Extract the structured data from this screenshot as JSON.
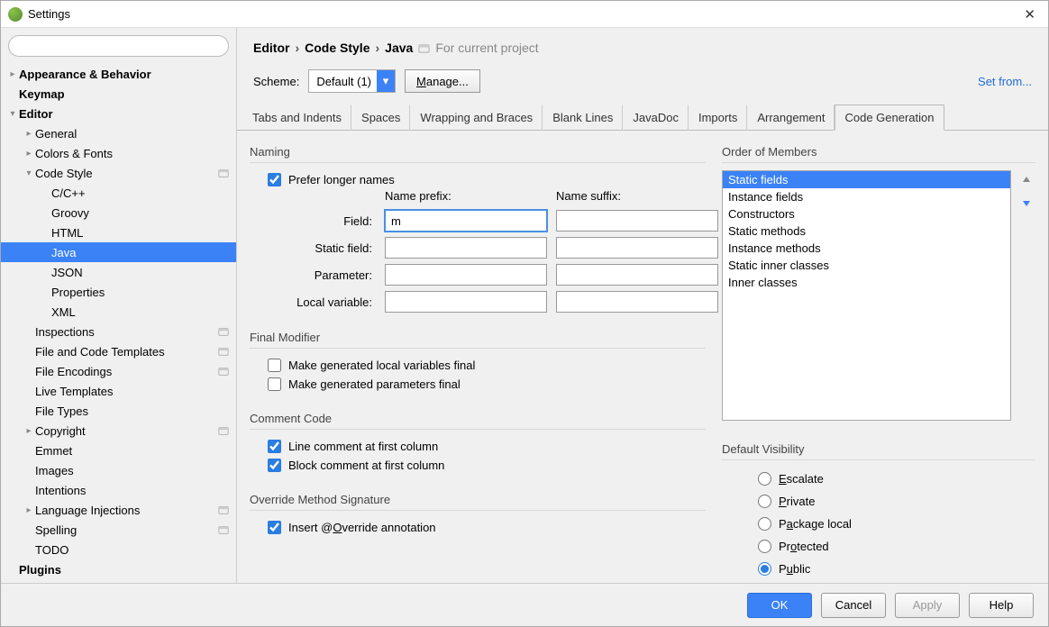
{
  "window": {
    "title": "Settings"
  },
  "sidebar": {
    "search_placeholder": "",
    "items": [
      {
        "label": "Appearance & Behavior",
        "depth": 0,
        "arrow": "right",
        "bold": true
      },
      {
        "label": "Keymap",
        "depth": 0,
        "arrow": "none",
        "bold": true
      },
      {
        "label": "Editor",
        "depth": 0,
        "arrow": "down",
        "bold": true
      },
      {
        "label": "General",
        "depth": 1,
        "arrow": "right"
      },
      {
        "label": "Colors & Fonts",
        "depth": 1,
        "arrow": "right"
      },
      {
        "label": "Code Style",
        "depth": 1,
        "arrow": "down",
        "project": true
      },
      {
        "label": "C/C++",
        "depth": 2,
        "arrow": "none"
      },
      {
        "label": "Groovy",
        "depth": 2,
        "arrow": "none"
      },
      {
        "label": "HTML",
        "depth": 2,
        "arrow": "none"
      },
      {
        "label": "Java",
        "depth": 2,
        "arrow": "none",
        "selected": true
      },
      {
        "label": "JSON",
        "depth": 2,
        "arrow": "none"
      },
      {
        "label": "Properties",
        "depth": 2,
        "arrow": "none"
      },
      {
        "label": "XML",
        "depth": 2,
        "arrow": "none"
      },
      {
        "label": "Inspections",
        "depth": 1,
        "arrow": "none",
        "project": true
      },
      {
        "label": "File and Code Templates",
        "depth": 1,
        "arrow": "none",
        "project": true
      },
      {
        "label": "File Encodings",
        "depth": 1,
        "arrow": "none",
        "project": true
      },
      {
        "label": "Live Templates",
        "depth": 1,
        "arrow": "none"
      },
      {
        "label": "File Types",
        "depth": 1,
        "arrow": "none"
      },
      {
        "label": "Copyright",
        "depth": 1,
        "arrow": "right",
        "project": true
      },
      {
        "label": "Emmet",
        "depth": 1,
        "arrow": "none"
      },
      {
        "label": "Images",
        "depth": 1,
        "arrow": "none"
      },
      {
        "label": "Intentions",
        "depth": 1,
        "arrow": "none"
      },
      {
        "label": "Language Injections",
        "depth": 1,
        "arrow": "right",
        "project": true
      },
      {
        "label": "Spelling",
        "depth": 1,
        "arrow": "none",
        "project": true
      },
      {
        "label": "TODO",
        "depth": 1,
        "arrow": "none"
      },
      {
        "label": "Plugins",
        "depth": 0,
        "arrow": "none",
        "bold": true
      }
    ]
  },
  "breadcrumb": {
    "parts": [
      "Editor",
      "Code Style",
      "Java"
    ],
    "hint": "For current project"
  },
  "scheme": {
    "label": "Scheme:",
    "value": "Default (1)",
    "manage": "Manage...",
    "set_from": "Set from..."
  },
  "tabs": [
    "Tabs and Indents",
    "Spaces",
    "Wrapping and Braces",
    "Blank Lines",
    "JavaDoc",
    "Imports",
    "Arrangement",
    "Code Generation"
  ],
  "active_tab": 7,
  "naming": {
    "header": "Naming",
    "prefer_longer": "Prefer longer names",
    "prefer_longer_checked": true,
    "prefix_hdr": "Name prefix:",
    "suffix_hdr": "Name suffix:",
    "rows": [
      {
        "label": "Field:",
        "prefix": "m",
        "suffix": "",
        "focused": true
      },
      {
        "label": "Static field:",
        "prefix": "",
        "suffix": ""
      },
      {
        "label": "Parameter:",
        "prefix": "",
        "suffix": ""
      },
      {
        "label": "Local variable:",
        "prefix": "",
        "suffix": ""
      }
    ]
  },
  "final_modifier": {
    "header": "Final Modifier",
    "local_vars": "Make generated local variables final",
    "local_vars_checked": false,
    "params": "Make generated parameters final",
    "params_checked": false
  },
  "comment_code": {
    "header": "Comment Code",
    "line": "Line comment at first column",
    "line_checked": true,
    "block": "Block comment at first column",
    "block_checked": true
  },
  "override_sig": {
    "header": "Override Method Signature",
    "insert": "Insert @Override annotation",
    "insert_checked": true
  },
  "order_members": {
    "header": "Order of Members",
    "items": [
      "Static fields",
      "Instance fields",
      "Constructors",
      "Static methods",
      "Instance methods",
      "Static inner classes",
      "Inner classes"
    ],
    "selected": 0
  },
  "default_visibility": {
    "header": "Default Visibility",
    "options": [
      "Escalate",
      "Private",
      "Package local",
      "Protected",
      "Public"
    ],
    "selected": 4
  },
  "footer": {
    "ok": "OK",
    "cancel": "Cancel",
    "apply": "Apply",
    "help": "Help"
  }
}
